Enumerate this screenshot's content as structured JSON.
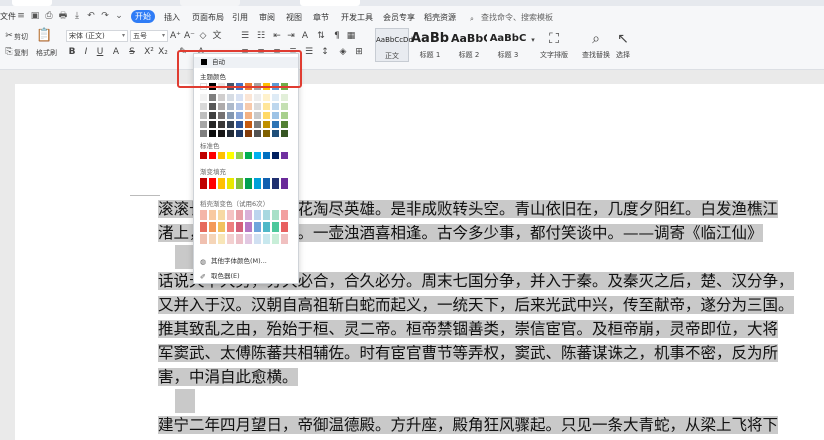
{
  "ribbon": {
    "file_label": "文件",
    "start_label": "开始",
    "menu": [
      "插入",
      "页面布局",
      "引用",
      "审阅",
      "视图",
      "章节",
      "开发工具",
      "会员专享",
      "稻壳资源"
    ],
    "search_placeholder": "查找命令、搜索模板",
    "cut_label": "剪切",
    "copy_label": "复制",
    "format_painter_label": "格式刷",
    "font_name": "宋体 (正文)",
    "font_size": "五号",
    "styles": [
      {
        "preview": "AaBbCcDd",
        "label": "正文"
      },
      {
        "preview": "AaBb",
        "label": "标题 1"
      },
      {
        "preview": "AaBbC",
        "label": "标题 2"
      },
      {
        "preview": "AaBbC",
        "label": "标题 3"
      }
    ],
    "text_layout_label": "文字排版",
    "find_replace_label": "查找替换",
    "select_label": "选择"
  },
  "color_popup": {
    "auto_label": "自动",
    "theme_colors_label": "主题颜色",
    "standard_colors_label": "标准色",
    "gradient_fill_label": "渐变填充",
    "docer_gradient_label": "稻壳渐变色（试用6次）",
    "more_colors_label": "其他字体颜色(M)...",
    "eyedropper_label": "取色器(E)",
    "theme_top_row": [
      "#ffffff",
      "#000000",
      "#e7e6e6",
      "#44546a",
      "#4472c4",
      "#ed7d31",
      "#a5a5a5",
      "#ffc000",
      "#5b9bd5",
      "#70ad47"
    ],
    "theme_columns": [
      [
        "#f2f2f2",
        "#d9d9d9",
        "#bfbfbf",
        "#a6a6a6",
        "#808080"
      ],
      [
        "#7f7f7f",
        "#595959",
        "#404040",
        "#262626",
        "#0d0d0d"
      ],
      [
        "#d0cece",
        "#aeabab",
        "#757171",
        "#3a3838",
        "#171616"
      ],
      [
        "#d6dce4",
        "#adb9ca",
        "#8497b0",
        "#333f4f",
        "#222a35"
      ],
      [
        "#d9e2f3",
        "#b4c6e7",
        "#8eaadb",
        "#2f5496",
        "#1f3864"
      ],
      [
        "#fbe5d5",
        "#f7caac",
        "#f4b183",
        "#c55a11",
        "#843c0b"
      ],
      [
        "#ededed",
        "#dbdbdb",
        "#c9c9c9",
        "#7b7b7b",
        "#525252"
      ],
      [
        "#fff2cc",
        "#ffe699",
        "#ffd966",
        "#bf9000",
        "#7f6000"
      ],
      [
        "#deebf6",
        "#bdd7ee",
        "#9dc3e6",
        "#2e75b5",
        "#1f4e79"
      ],
      [
        "#e2efd9",
        "#c5e0b3",
        "#a8d08d",
        "#538135",
        "#375623"
      ]
    ],
    "standard_colors": [
      "#c00000",
      "#ff0000",
      "#ffc000",
      "#ffff00",
      "#92d050",
      "#00b050",
      "#00b0f0",
      "#0070c0",
      "#002060",
      "#7030a0"
    ],
    "gradient_colors": [
      "#c00000",
      "#ff0000",
      "#ffc000",
      "#e8e800",
      "#7fbf3f",
      "#00a050",
      "#00a0d8",
      "#1060b0",
      "#203070",
      "#6a2a9a"
    ],
    "docer_rows": [
      [
        "#f4b6a8",
        "#f8c9a0",
        "#f7d9a3",
        "#f5c3c3",
        "#e8a0a8",
        "#d9b0d8",
        "#bcd4ee",
        "#a8d8e0",
        "#a8e0c8",
        "#f2a0a0"
      ],
      [
        "#e66b5e",
        "#f39a5a",
        "#f2c25e",
        "#ee7f7f",
        "#d4607a",
        "#b678c4",
        "#6fa5dc",
        "#4fb8c8",
        "#4cc89c",
        "#e86060"
      ],
      [
        "#f0c0b0",
        "#f5d5b8",
        "#f8e6b8",
        "#f3d0d0",
        "#ecc0c8",
        "#e2c8e2",
        "#d0e0f2",
        "#c8e8ee",
        "#c8eed8",
        "#f0c0c0"
      ]
    ]
  },
  "document": {
    "lines": [
      {
        "text": "滚滚长江东逝水，浪花淘尽英雄。是非成败转头空。青山依旧在，几度夕阳红。白发渔樵江",
        "visible_from": 0
      },
      {
        "text": "渚上，惯看秋月春风。一壶浊酒喜相逢。古今多少事，都付笑谈中。——调寄《临江仙》",
        "visible_from": 0
      },
      {
        "text": "",
        "visible_from": 0
      },
      {
        "text": "话说天下大势，分久必合，合久必分。周末七国分争，并入于秦。及秦灭之后，楚、汉分争，",
        "visible_from": 0
      },
      {
        "text": "又并入于汉。汉朝自高祖斩白蛇而起义，一统天下，后来光武中兴，传至献帝，遂分为三国。",
        "visible_from": 0
      },
      {
        "text": "推其致乱之由，殆始于桓、灵二帝。桓帝禁锢善类，崇信宦官。及桓帝崩，灵帝即位，大将",
        "visible_from": 0
      },
      {
        "text": "军窦武、太傅陈蕃共相辅佐。时有宦官曹节等弄权，窦武、陈蕃谋诛之，机事不密，反为所",
        "visible_from": 0
      },
      {
        "text": "害，中涓自此愈横。",
        "visible_from": 0
      },
      {
        "text": "",
        "visible_from": 0
      },
      {
        "text": "建宁二年四月望日，帝御温德殿。方升座，殿角狂风骤起。只见一条大青蛇，从梁上飞将下",
        "visible_from": 0
      }
    ]
  }
}
